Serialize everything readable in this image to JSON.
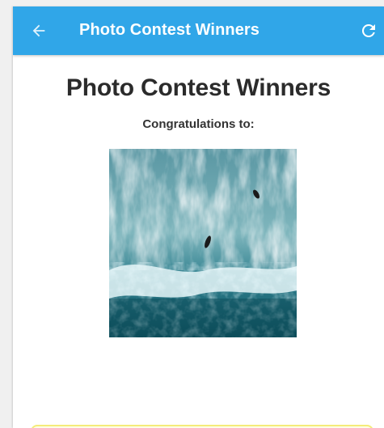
{
  "header": {
    "title": "Photo Contest Winners",
    "back_icon": "arrow-left-icon",
    "refresh_icon": "refresh-icon",
    "accent_color": "#30a6e8"
  },
  "main": {
    "heading": "Photo Contest Winners",
    "subheading": "Congratulations to:",
    "winner_photo": "aerial ocean waves photo with surfers"
  },
  "colors": {
    "card_border": "#f4ec7a",
    "background": "#ffffff"
  }
}
